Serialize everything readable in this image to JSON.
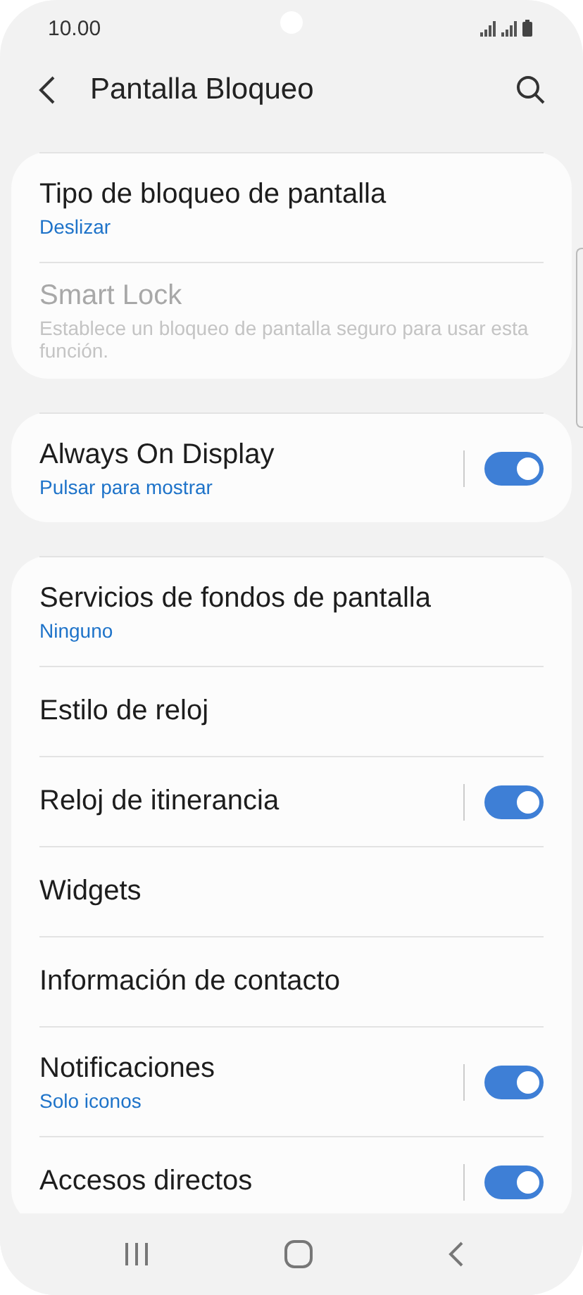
{
  "status_bar": {
    "time": "10.00"
  },
  "header": {
    "title": "Pantalla Bloqueo"
  },
  "cards": [
    {
      "items": [
        {
          "kind": "nav",
          "title": "Tipo de bloqueo de pantalla",
          "subtitle": "Deslizar",
          "disabled": false
        },
        {
          "kind": "nav",
          "title": "Smart Lock",
          "subtitle": "Establece un bloqueo de pantalla seguro para usar esta función.",
          "disabled": true
        }
      ]
    },
    {
      "items": [
        {
          "kind": "switch",
          "title": "Always On Display",
          "subtitle": "Pulsar para mostrar",
          "on": true
        }
      ]
    },
    {
      "items": [
        {
          "kind": "nav",
          "title": "Servicios de fondos de pantalla",
          "subtitle": "Ninguno",
          "disabled": false
        },
        {
          "kind": "nav",
          "title": "Estilo de reloj",
          "disabled": false
        },
        {
          "kind": "switch",
          "title": "Reloj de itinerancia",
          "on": true
        },
        {
          "kind": "nav",
          "title": "Widgets",
          "disabled": false
        },
        {
          "kind": "nav",
          "title": "Información de contacto",
          "disabled": false
        },
        {
          "kind": "switch",
          "title": "Notificaciones",
          "subtitle": "Solo iconos",
          "on": true
        },
        {
          "kind": "switch",
          "title": "Accesos directos",
          "on": true
        }
      ]
    }
  ]
}
